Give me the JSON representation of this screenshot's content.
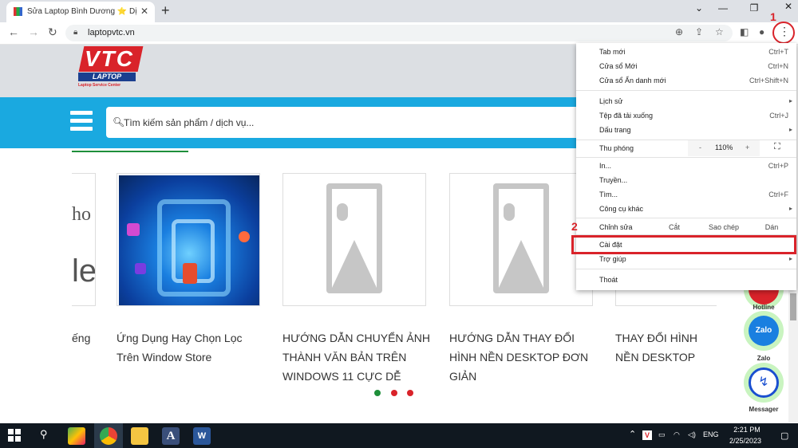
{
  "browser": {
    "tab_title": "Sửa Laptop Bình Dương ⭐ Dịch V",
    "url": "laptopvtc.vn"
  },
  "site": {
    "logo_top": "VTC",
    "logo_mid": "LAPTOP",
    "logo_sub": "Laptop Service Center",
    "search_placeholder": "Tìm kiếm sản phẩm / dịch vụ...",
    "partial_left_text_1": "ho",
    "partial_left_text_2": "le",
    "partial_caption": "ếng",
    "cards": [
      {
        "caption": "Ứng Dụng Hay Chọn Lọc Trên Window Store"
      },
      {
        "caption": "HƯỚNG DẪN CHUYỂN ẢNH THÀNH VĂN BẢN TRÊN WINDOWS 11 CỰC DỄ"
      },
      {
        "caption": "HƯỚNG DẪN THAY ĐỔI HÌNH NỀN DESKTOP ĐƠN GIẢN"
      },
      {
        "caption": "THAY ĐỔI HÌNH NỀN DESKTOP ĐƠN GIẢ"
      }
    ],
    "dot_colors": [
      "#1e8f3a",
      "#d9232a",
      "#d9232a"
    ],
    "contacts": {
      "hotline": "Hotline",
      "zalo": "Zalo",
      "zalo_icon": "Zalo",
      "messenger": "Messager"
    }
  },
  "annotations": {
    "step1": "1",
    "step2": "2"
  },
  "menu": {
    "new_tab": "Tab mới",
    "new_tab_sc": "Ctrl+T",
    "new_window": "Cửa sổ Mới",
    "new_window_sc": "Ctrl+N",
    "incognito": "Cửa sổ Ẩn danh mới",
    "incognito_sc": "Ctrl+Shift+N",
    "history": "Lịch sử",
    "downloads": "Tệp đã tải xuống",
    "downloads_sc": "Ctrl+J",
    "bookmarks": "Dấu trang",
    "zoom": "Thu phóng",
    "zoom_minus": "-",
    "zoom_value": "110%",
    "zoom_plus": "+",
    "print": "In...",
    "print_sc": "Ctrl+P",
    "cast": "Truyền...",
    "find": "Tìm...",
    "find_sc": "Ctrl+F",
    "more_tools": "Công cụ khác",
    "edit": "Chỉnh sửa",
    "cut": "Cắt",
    "copy": "Sao chép",
    "paste": "Dán",
    "settings": "Cài đặt",
    "help": "Trợ giúp",
    "exit": "Thoát"
  },
  "taskbar": {
    "lang": "ENG",
    "time": "2:21 PM",
    "date": "2/25/2023"
  }
}
